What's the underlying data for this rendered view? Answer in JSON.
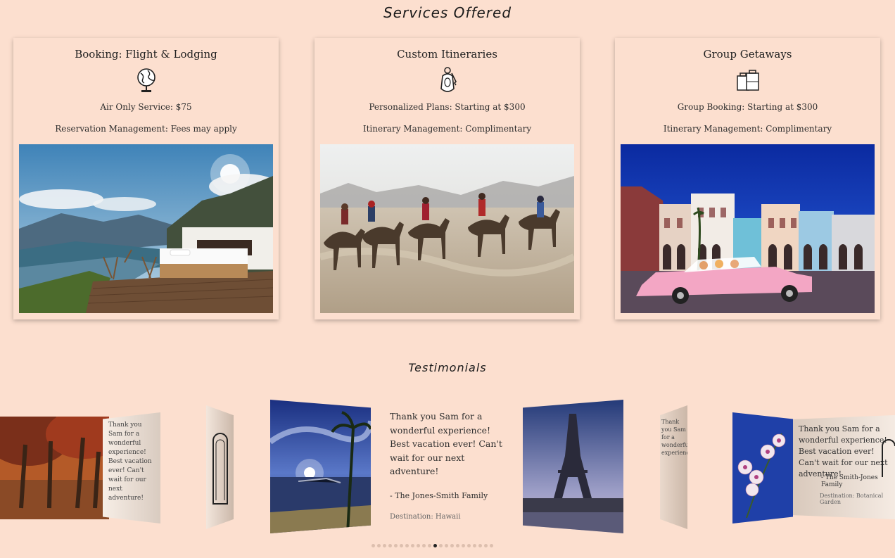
{
  "services": {
    "title": "Services Offered",
    "cards": [
      {
        "title": "Booking: Flight & Lodging",
        "icon": "globe-icon",
        "line1": "Air Only Service: $75",
        "line2": "Reservation Management: Fees may apply",
        "photo": "mountain-lake-bed-photo"
      },
      {
        "title": "Custom Itineraries",
        "icon": "key-tag-icon",
        "line1": "Personalized Plans: Starting at $300",
        "line2": "Itinerary Management: Complimentary",
        "photo": "desert-camel-caravan-photo"
      },
      {
        "title": "Group Getaways",
        "icon": "luggage-icon",
        "line1": "Group Booking: Starting at $300",
        "line2": "Itinerary Management: Complimentary",
        "photo": "havana-pink-car-photo"
      }
    ]
  },
  "testimonials": {
    "title": "Testimonials",
    "current": {
      "quote": "Thank you Sam for a wonderful experience! Best vacation ever! Can't wait for our next adventure!",
      "author": "- The Jones-Smith Family",
      "destination": "Destination: Hawaii"
    },
    "side_right_quote": "Thank you Sam for a wonderful experience! Best vacation ever! Can't wait for our next adventure!",
    "side_right_author": "- The Smith-Jones Family",
    "side_right_destination": "Destination: Botanical Garden",
    "dots_total": 22,
    "dots_active_index": 11
  },
  "colors": {
    "background": "#fcdfcf",
    "text": "#2a2a2a",
    "dot": "#ddbfae",
    "dot_active": "#222222"
  }
}
